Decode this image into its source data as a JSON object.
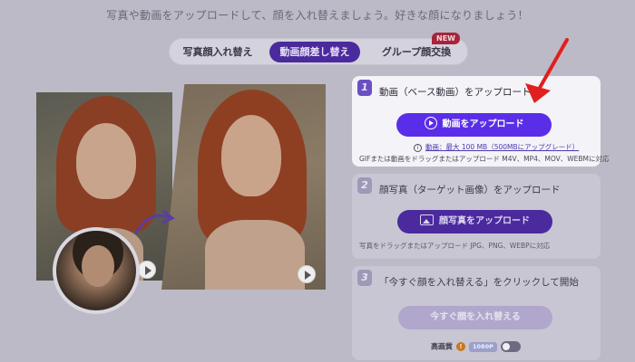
{
  "header": {
    "subtitle": "写真や動画をアップロードして、顔を入れ替えましょう。好きな顔になりましょう！"
  },
  "tabs": [
    {
      "label": "写真顔入れ替え",
      "active": false
    },
    {
      "label": "動画顔差し替え",
      "active": true
    },
    {
      "label": "グループ顔交換",
      "active": false
    }
  ],
  "new_badge": "NEW",
  "steps": {
    "step1": {
      "number": "1",
      "title": "動画（ベース動画）をアップロード",
      "button": "動画をアップロード",
      "limit_text": "動画：最大 100 MB（500MBにアップグレード）",
      "hint": "GIFまたは動画をドラッグまたはアップロード M4V、MP4、MOV、WEBMに対応"
    },
    "step2": {
      "number": "2",
      "title": "顔写真（ターゲット画像）をアップロード",
      "button": "顔写真をアップロード",
      "hint": "写真をドラッグまたはアップロード JPG、PNG、WEBPに対応"
    },
    "step3": {
      "number": "3",
      "title": "「今すぐ顔を入れ替える」をクリックして開始",
      "button": "今すぐ顔を入れ替える",
      "hq_label": "高画質",
      "hq_badge": "1080P",
      "hq_enabled": false
    }
  },
  "icons": {
    "play": "play-icon",
    "image": "image-icon",
    "info": "info-icon",
    "warning": "warning-icon",
    "arrow": "arrow-icon"
  },
  "colors": {
    "accent": "#5a2ee8",
    "tab_active": "#4b2a9e",
    "badge_new": "#a8243c",
    "pointer_arrow": "#e0201e"
  }
}
